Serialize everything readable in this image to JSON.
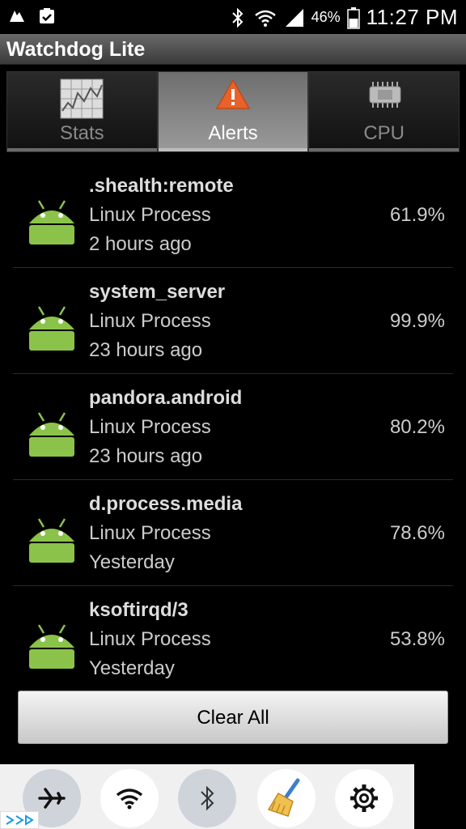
{
  "status_bar": {
    "battery_percent": "46%",
    "time": "11:27 PM"
  },
  "app": {
    "title": "Watchdog Lite"
  },
  "tabs": [
    {
      "label": "Stats",
      "icon": "chart-icon",
      "selected": false
    },
    {
      "label": "Alerts",
      "icon": "warning-icon",
      "selected": true
    },
    {
      "label": "CPU",
      "icon": "chip-icon",
      "selected": false
    }
  ],
  "alerts": [
    {
      "name": ".shealth:remote",
      "type": "Linux Process",
      "time": "2 hours ago",
      "percent": "61.9%"
    },
    {
      "name": "system_server",
      "type": "Linux Process",
      "time": "23 hours ago",
      "percent": "99.9%"
    },
    {
      "name": "pandora.android",
      "type": "Linux Process",
      "time": "23 hours ago",
      "percent": "80.2%"
    },
    {
      "name": "d.process.media",
      "type": "Linux Process",
      "time": "Yesterday",
      "percent": "78.6%"
    },
    {
      "name": "ksoftirqd/3",
      "type": "Linux Process",
      "time": "Yesterday",
      "percent": "53.8%"
    }
  ],
  "actions": {
    "clear_all_label": "Clear All"
  },
  "shortcuts": [
    {
      "icon": "airplane-icon"
    },
    {
      "icon": "wifi-icon"
    },
    {
      "icon": "bluetooth-icon"
    },
    {
      "icon": "broom-icon"
    },
    {
      "icon": "gear-icon"
    }
  ],
  "colors": {
    "android_green": "#8bc34a",
    "warning_orange": "#e8622a"
  }
}
